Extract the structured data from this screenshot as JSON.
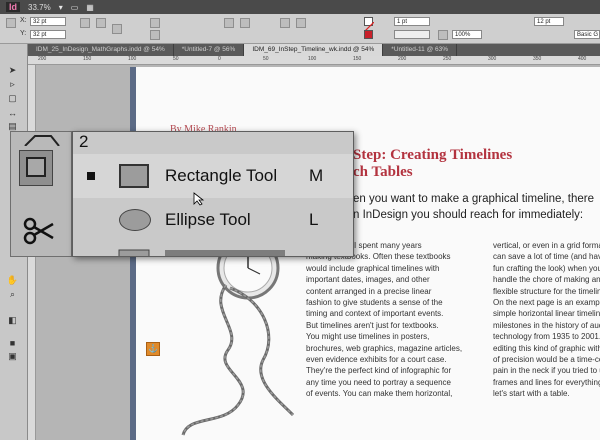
{
  "app": {
    "logo": "Id",
    "zoom": "33.7%"
  },
  "control_panel": {
    "x_value": "32 pt",
    "y_value": "32 pt",
    "stroke_weight": "1 pt",
    "opacity": "100%",
    "gap_value": "12 pt",
    "style_value": "Basic G"
  },
  "tabs": [
    {
      "label": "IDM_25_InDesign_MathGraphs.indd @ 54%"
    },
    {
      "label": "*Untitled-7 @ 56%"
    },
    {
      "label": "IDM_69_InStep_Timeline_wk.indd @ 54%"
    },
    {
      "label": "*Untitled-11 @ 63%"
    }
  ],
  "ruler": {
    "marks": [
      "200",
      "150",
      "100",
      "50",
      "0",
      "50",
      "100",
      "150",
      "200",
      "250",
      "300",
      "350",
      "400"
    ]
  },
  "document": {
    "byline": "By Mike Rankin",
    "title_line1": "Step: Creating Timelines",
    "title_line2": "ch Tables",
    "intro_line1": "en you want to make a graphical timeline, there",
    "intro_line2": "n InDesign you should reach for immediately:",
    "column1": [
      "in my career, I spent many years",
      "making textbooks. Often these textbooks",
      "would include graphical timelines with",
      "important dates, images, and other",
      "content arranged in a precise linear",
      "fashion to give students a sense of the",
      "timing and context of important events.",
      "   But timelines aren't just for textbooks.",
      "You might use timelines in posters,",
      "brochures, web graphics, magazine articles,",
      "even evidence exhibits for a court case.",
      "They're the perfect kind of infographic for",
      "any time you need to portray a sequence",
      "of events. You can make them horizontal,"
    ],
    "column2": [
      "vertical, or even in a grid forma",
      "can save a lot of time (and have",
      "fun crafting the look) when you",
      "handle the chore of making an",
      "flexible structure for the timeline",
      "   On the next page is an examp",
      "simple horizontal linear timelin",
      "milestones in the history of aud",
      "technology from 1935 to 2001. I",
      "editing this kind of graphic with",
      "of precision would be a time-co",
      "pain in the neck if you tried to u",
      "frames and lines for everything.",
      "let's start with a table."
    ]
  },
  "flyout": {
    "items": [
      {
        "label": "Rectangle Tool",
        "shortcut": "M",
        "icon": "rectangle-icon",
        "selected": true
      },
      {
        "label": "Ellipse Tool",
        "shortcut": "L",
        "icon": "ellipse-icon",
        "selected": false
      }
    ]
  },
  "colors": {
    "title_red": "#b3333f",
    "flyout_bg": "#c9c9c9",
    "anchor_orange": "#e08a2a"
  }
}
